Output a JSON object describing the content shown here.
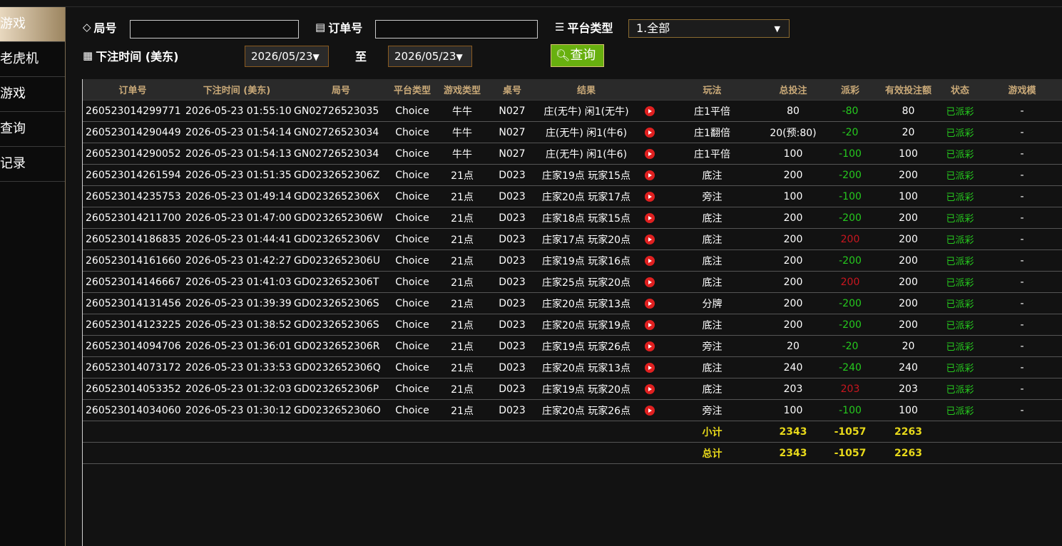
{
  "sidebar": {
    "items": [
      {
        "label": "游戏",
        "active": true
      },
      {
        "label": "老虎机",
        "active": false
      },
      {
        "label": "游戏",
        "active": false
      },
      {
        "label": "查询",
        "active": false
      },
      {
        "label": "记录",
        "active": false
      }
    ]
  },
  "filters": {
    "round_label": "局号",
    "round_value": "",
    "order_label": "订单号",
    "order_value": "",
    "platform_label": "平台类型",
    "platform_value": "1.全部",
    "bet_time_label": "下注时间 (美东)",
    "date_from": "2026/05/23",
    "to_label": "至",
    "date_to": "2026/05/23",
    "query_label": "查询"
  },
  "table": {
    "headers": [
      "订单号",
      "下注时间 (美东)",
      "局号",
      "平台类型",
      "游戏类型",
      "桌号",
      "结果",
      "",
      "玩法",
      "总投注",
      "派彩",
      "有效投注额",
      "状态",
      "游戏模"
    ],
    "rows": [
      {
        "order": "260523014299771",
        "time": "2026-05-23 01:55:10",
        "round": "GN02726523035",
        "platform": "Choice",
        "game": "牛牛",
        "table": "N027",
        "result": "庄(无牛) 闲1(无牛)",
        "play": "庄1平倍",
        "bet": "80",
        "payout": "-80",
        "payout_sign": "neg",
        "valid": "80",
        "status": "已派彩",
        "mode": "-"
      },
      {
        "order": "260523014290449",
        "time": "2026-05-23 01:54:14",
        "round": "GN02726523034",
        "platform": "Choice",
        "game": "牛牛",
        "table": "N027",
        "result": "庄(无牛) 闲1(牛6)",
        "play": "庄1翻倍",
        "bet": "20(预:80)",
        "payout": "-20",
        "payout_sign": "neg",
        "valid": "20",
        "status": "已派彩",
        "mode": "-"
      },
      {
        "order": "260523014290052",
        "time": "2026-05-23 01:54:13",
        "round": "GN02726523034",
        "platform": "Choice",
        "game": "牛牛",
        "table": "N027",
        "result": "庄(无牛) 闲1(牛6)",
        "play": "庄1平倍",
        "bet": "100",
        "payout": "-100",
        "payout_sign": "neg",
        "valid": "100",
        "status": "已派彩",
        "mode": "-"
      },
      {
        "order": "260523014261594",
        "time": "2026-05-23 01:51:35",
        "round": "GD0232652306Z",
        "platform": "Choice",
        "game": "21点",
        "table": "D023",
        "result": "庄家19点 玩家15点",
        "play": "底注",
        "bet": "200",
        "payout": "-200",
        "payout_sign": "neg",
        "valid": "200",
        "status": "已派彩",
        "mode": "-"
      },
      {
        "order": "260523014235753",
        "time": "2026-05-23 01:49:14",
        "round": "GD0232652306X",
        "platform": "Choice",
        "game": "21点",
        "table": "D023",
        "result": "庄家20点 玩家17点",
        "play": "旁注",
        "bet": "100",
        "payout": "-100",
        "payout_sign": "neg",
        "valid": "100",
        "status": "已派彩",
        "mode": "-"
      },
      {
        "order": "260523014211700",
        "time": "2026-05-23 01:47:00",
        "round": "GD0232652306W",
        "platform": "Choice",
        "game": "21点",
        "table": "D023",
        "result": "庄家18点 玩家15点",
        "play": "底注",
        "bet": "200",
        "payout": "-200",
        "payout_sign": "neg",
        "valid": "200",
        "status": "已派彩",
        "mode": "-"
      },
      {
        "order": "260523014186835",
        "time": "2026-05-23 01:44:41",
        "round": "GD0232652306V",
        "platform": "Choice",
        "game": "21点",
        "table": "D023",
        "result": "庄家17点 玩家20点",
        "play": "底注",
        "bet": "200",
        "payout": "200",
        "payout_sign": "pos",
        "valid": "200",
        "status": "已派彩",
        "mode": "-"
      },
      {
        "order": "260523014161660",
        "time": "2026-05-23 01:42:27",
        "round": "GD0232652306U",
        "platform": "Choice",
        "game": "21点",
        "table": "D023",
        "result": "庄家19点 玩家16点",
        "play": "底注",
        "bet": "200",
        "payout": "-200",
        "payout_sign": "neg",
        "valid": "200",
        "status": "已派彩",
        "mode": "-"
      },
      {
        "order": "260523014146667",
        "time": "2026-05-23 01:41:03",
        "round": "GD0232652306T",
        "platform": "Choice",
        "game": "21点",
        "table": "D023",
        "result": "庄家25点 玩家20点",
        "play": "底注",
        "bet": "200",
        "payout": "200",
        "payout_sign": "pos",
        "valid": "200",
        "status": "已派彩",
        "mode": "-"
      },
      {
        "order": "260523014131456",
        "time": "2026-05-23 01:39:39",
        "round": "GD0232652306S",
        "platform": "Choice",
        "game": "21点",
        "table": "D023",
        "result": "庄家20点 玩家13点",
        "play": "分牌",
        "bet": "200",
        "payout": "-200",
        "payout_sign": "neg",
        "valid": "200",
        "status": "已派彩",
        "mode": "-"
      },
      {
        "order": "260523014123225",
        "time": "2026-05-23 01:38:52",
        "round": "GD0232652306S",
        "platform": "Choice",
        "game": "21点",
        "table": "D023",
        "result": "庄家20点 玩家19点",
        "play": "底注",
        "bet": "200",
        "payout": "-200",
        "payout_sign": "neg",
        "valid": "200",
        "status": "已派彩",
        "mode": "-"
      },
      {
        "order": "260523014094706",
        "time": "2026-05-23 01:36:01",
        "round": "GD0232652306R",
        "platform": "Choice",
        "game": "21点",
        "table": "D023",
        "result": "庄家19点 玩家26点",
        "play": "旁注",
        "bet": "20",
        "payout": "-20",
        "payout_sign": "neg",
        "valid": "20",
        "status": "已派彩",
        "mode": "-"
      },
      {
        "order": "260523014073172",
        "time": "2026-05-23 01:33:53",
        "round": "GD0232652306Q",
        "platform": "Choice",
        "game": "21点",
        "table": "D023",
        "result": "庄家20点 玩家13点",
        "play": "底注",
        "bet": "240",
        "payout": "-240",
        "payout_sign": "neg",
        "valid": "240",
        "status": "已派彩",
        "mode": "-"
      },
      {
        "order": "260523014053352",
        "time": "2026-05-23 01:32:03",
        "round": "GD0232652306P",
        "platform": "Choice",
        "game": "21点",
        "table": "D023",
        "result": "庄家19点 玩家20点",
        "play": "底注",
        "bet": "203",
        "payout": "203",
        "payout_sign": "pos",
        "valid": "203",
        "status": "已派彩",
        "mode": "-"
      },
      {
        "order": "260523014034060",
        "time": "2026-05-23 01:30:12",
        "round": "GD0232652306O",
        "platform": "Choice",
        "game": "21点",
        "table": "D023",
        "result": "庄家20点 玩家26点",
        "play": "旁注",
        "bet": "100",
        "payout": "-100",
        "payout_sign": "neg",
        "valid": "100",
        "status": "已派彩",
        "mode": "-"
      }
    ],
    "subtotal": {
      "label": "小计",
      "bet": "2343",
      "payout": "-1057",
      "valid": "2263"
    },
    "total": {
      "label": "总计",
      "bet": "2343",
      "payout": "-1057",
      "valid": "2263"
    }
  }
}
